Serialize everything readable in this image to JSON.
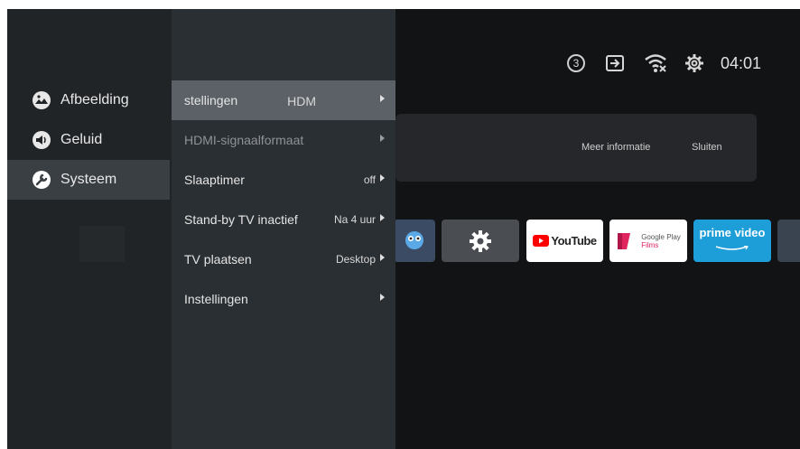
{
  "status_bar": {
    "notification_count": "3",
    "clock": "04:01",
    "icons": [
      "notification-badge",
      "input-icon",
      "wifi-icon",
      "settings-gear-icon"
    ]
  },
  "banner": {
    "more_info": "Meer informatie",
    "close": "Sluiten"
  },
  "apps": {
    "youtube": "YouTube",
    "google_play_top": "Google Play",
    "google_play_bottom": "Films",
    "prime": "prime video"
  },
  "categories": [
    {
      "label": "Afbeelding",
      "icon": "picture-icon"
    },
    {
      "label": "Geluid",
      "icon": "sound-icon"
    },
    {
      "label": "Systeem",
      "icon": "wrench-icon",
      "selected": true
    }
  ],
  "submenu": [
    {
      "label": "stellingen",
      "value": "HDM",
      "selected": true
    },
    {
      "label": "HDMI-signaalformaat",
      "value": "",
      "disabled": true
    },
    {
      "label": "Slaaptimer",
      "value": "off"
    },
    {
      "label": "Stand-by TV inactief",
      "value": "Na 4 uur"
    },
    {
      "label": "TV plaatsen",
      "value": "Desktop"
    },
    {
      "label": "Instellingen",
      "value": ""
    }
  ],
  "colors": {
    "background": "#121315",
    "category_panel": "#202427",
    "submenu_panel": "#2a2f33",
    "selected_row": "#5b6166",
    "prime_blue": "#1d9ed9",
    "youtube_red": "#ff0000"
  }
}
